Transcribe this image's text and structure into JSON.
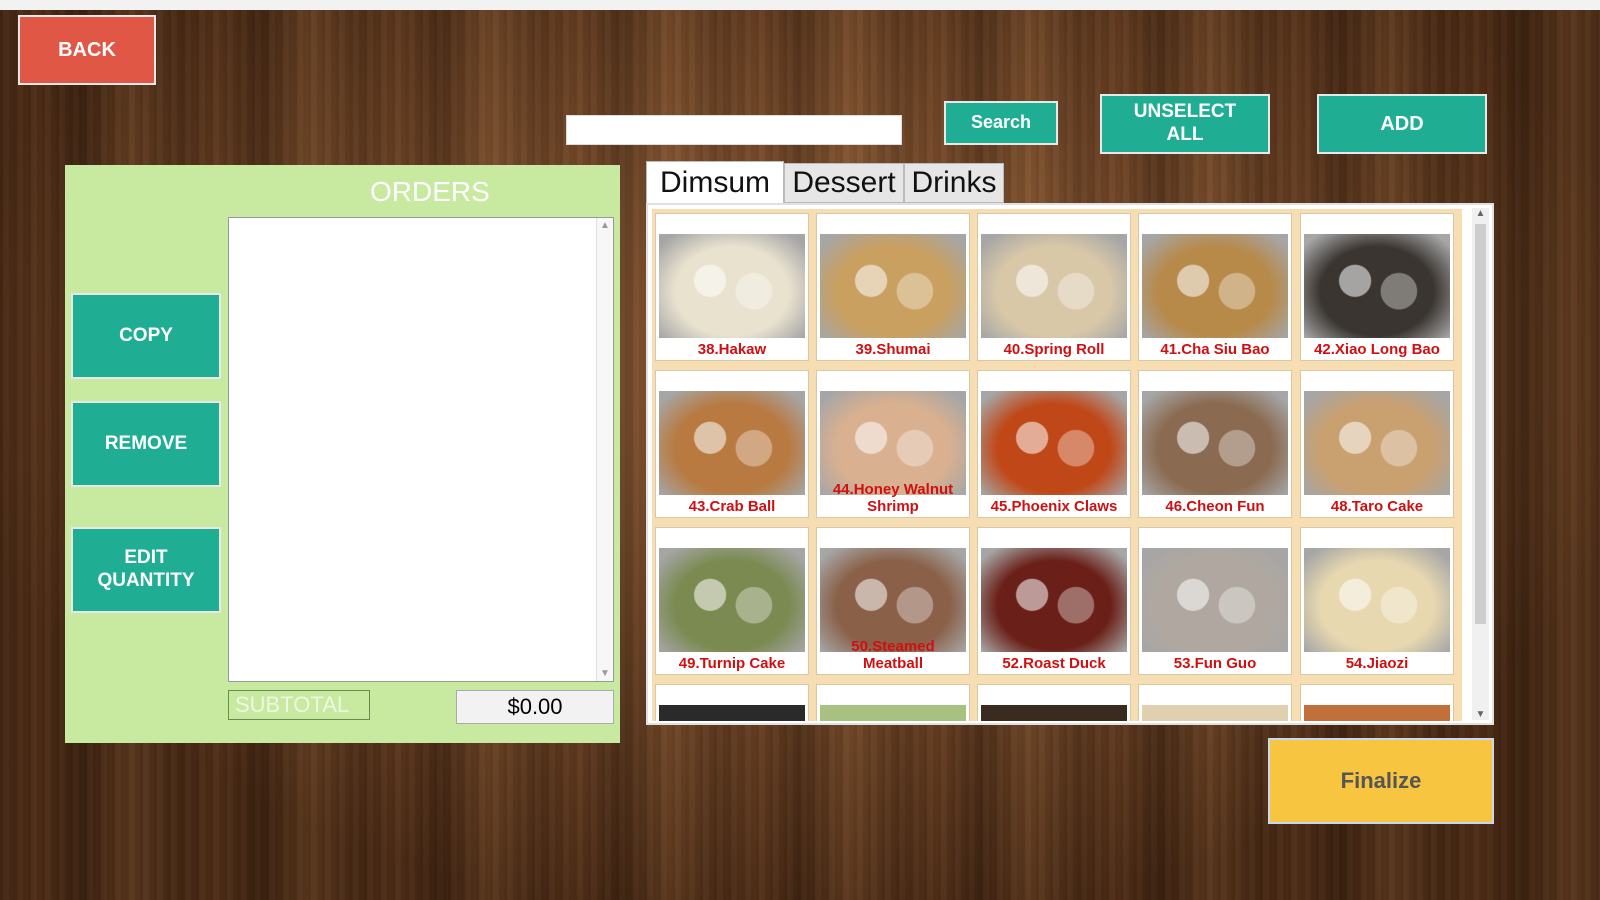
{
  "header": {
    "back_label": "BACK",
    "search_value": "",
    "search_label": "Search",
    "unselect_label": "UNSELECT\nALL",
    "add_label": "ADD"
  },
  "orders": {
    "title": "ORDERS",
    "copy_label": "COPY",
    "remove_label": "REMOVE",
    "edit_label": "EDIT\nQUANTITY",
    "subtotal_label": "SUBTOTAL",
    "subtotal_value": "$0.00",
    "items": []
  },
  "menu": {
    "tabs": [
      {
        "label": "Dimsum",
        "active": true
      },
      {
        "label": "Dessert",
        "active": false
      },
      {
        "label": "Drinks",
        "active": false
      }
    ],
    "items": [
      {
        "label": "38.Hakaw",
        "icon": "har-gow-icon",
        "color": "#e9e2cf"
      },
      {
        "label": "39.Shumai",
        "icon": "shumai-icon",
        "color": "#c9a060"
      },
      {
        "label": "40.Spring Roll",
        "icon": "spring-roll-icon",
        "color": "#d9c8a8"
      },
      {
        "label": "41.Cha Siu Bao",
        "icon": "bun-icon",
        "color": "#b78a4a"
      },
      {
        "label": "42.Xiao Long Bao",
        "icon": "soup-dumpling-icon",
        "color": "#3a3530"
      },
      {
        "label": "43.Crab Ball",
        "icon": "crab-ball-icon",
        "color": "#b87a40"
      },
      {
        "label": "44.Honey Walnut\nShrimp",
        "icon": "shrimp-icon",
        "color": "#d9b090"
      },
      {
        "label": "45.Phoenix Claws",
        "icon": "chicken-feet-icon",
        "color": "#c04818"
      },
      {
        "label": "46.Cheon Fun",
        "icon": "rice-roll-icon",
        "color": "#8a6a50"
      },
      {
        "label": "48.Taro Cake",
        "icon": "taro-cake-icon",
        "color": "#c9a070"
      },
      {
        "label": "49.Turnip Cake",
        "icon": "turnip-cake-icon",
        "color": "#7a8a50"
      },
      {
        "label": "50.Steamed\nMeatball",
        "icon": "meatball-icon",
        "color": "#8a6048"
      },
      {
        "label": "52.Roast Duck",
        "icon": "roast-duck-icon",
        "color": "#6a2018"
      },
      {
        "label": "53.Fun Guo",
        "icon": "fun-guo-icon",
        "color": "#b0a8a0"
      },
      {
        "label": "54.Jiaozi",
        "icon": "jiaozi-icon",
        "color": "#e8d8b0"
      }
    ],
    "partial_row_colors": [
      "#2a2a2a",
      "#a8c080",
      "#3a2a20",
      "#e0d0b0",
      "#c07038"
    ]
  },
  "footer": {
    "finalize_label": "Finalize"
  }
}
